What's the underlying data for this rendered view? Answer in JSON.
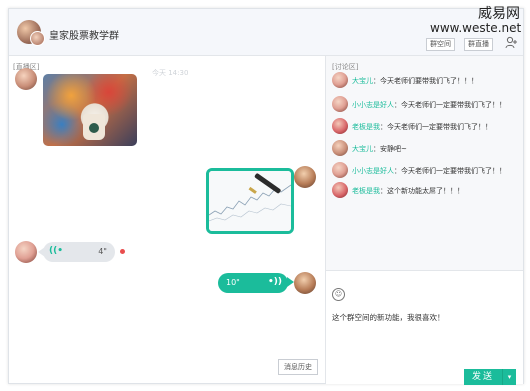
{
  "header": {
    "group_name": "皇家股票教学群",
    "space_button": "群空间",
    "live_button": "群直播",
    "add_member_icon": "add-user-icon"
  },
  "watermark": {
    "line1": "威易网",
    "line2": "www.weste.net"
  },
  "live": {
    "section_label": "[直播区]",
    "faint_time": "今天 14:30",
    "voice_in_length": "4\"",
    "voice_out_length": "10\"",
    "history_button": "消息历史"
  },
  "discussion": {
    "section_label": "[讨论区]",
    "messages": [
      {
        "nick": "大宝儿",
        "text": "今天老师们要带我们飞了！！！"
      },
      {
        "nick": "小小志是好人",
        "text": "今天老师们一定要带我们飞了！！"
      },
      {
        "nick": "老板是我",
        "text": "今天老师们一定要带我们飞了！！"
      },
      {
        "nick": "大宝儿",
        "text": "安静吧~"
      },
      {
        "nick": "小小志是好人",
        "text": "今天老师们一定要带我们飞了！！"
      },
      {
        "nick": "老板是我",
        "text": "这个新功能太屌了！！！"
      }
    ],
    "separator": "：",
    "input_text": "这个群空间的新功能，我很喜欢！",
    "send_label": "发送"
  },
  "colors": {
    "accent": "#1bbc9b",
    "unread_dot": "#e94d4d"
  }
}
